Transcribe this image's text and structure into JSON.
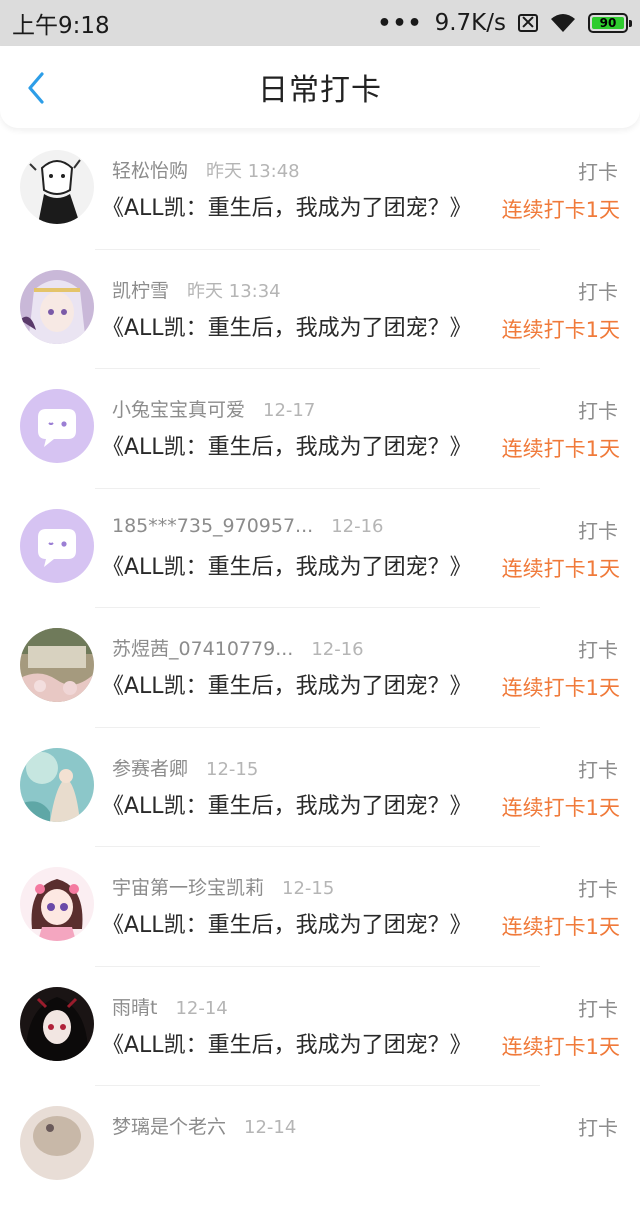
{
  "status_bar": {
    "time": "上午9:18",
    "dots": "•••",
    "speed": "9.7K/s",
    "battery": "90",
    "battery_color": "#2ecc2e"
  },
  "header": {
    "title": "日常打卡",
    "back_icon": "chevron-left-icon",
    "accent": "#2d9ee8"
  },
  "colors": {
    "streak": "#f07a3a",
    "muted": "#8c8c8c"
  },
  "entries": [
    {
      "user": "轻松怡购",
      "time": "昨天 13:48",
      "book": "《ALL凯：重生后，我成为了团宠？》",
      "action": "打卡",
      "streak": "连续打卡1天",
      "avatar": "sketch-avatar"
    },
    {
      "user": "凯柠雪",
      "time": "昨天 13:34",
      "book": "《ALL凯：重生后，我成为了团宠？》",
      "action": "打卡",
      "streak": "连续打卡1天",
      "avatar": "anime-avatar"
    },
    {
      "user": "小兔宝宝真可爱",
      "time": "12-17",
      "book": "《ALL凯：重生后，我成为了团宠？》",
      "action": "打卡",
      "streak": "连续打卡1天",
      "avatar": "default-chat-avatar"
    },
    {
      "user": "185***735_970957...",
      "time": "12-16",
      "book": "《ALL凯：重生后，我成为了团宠？》",
      "action": "打卡",
      "streak": "连续打卡1天",
      "avatar": "default-chat-avatar"
    },
    {
      "user": "苏煜茜_07410779...",
      "time": "12-16",
      "book": "《ALL凯：重生后，我成为了团宠？》",
      "action": "打卡",
      "streak": "连续打卡1天",
      "avatar": "photo-avatar"
    },
    {
      "user": "参赛者卿",
      "time": "12-15",
      "book": "《ALL凯：重生后，我成为了团宠？》",
      "action": "打卡",
      "streak": "连续打卡1天",
      "avatar": "art-avatar"
    },
    {
      "user": "宇宙第一珍宝凯莉",
      "time": "12-15",
      "book": "《ALL凯：重生后，我成为了团宠？》",
      "action": "打卡",
      "streak": "连续打卡1天",
      "avatar": "anime-girl-avatar"
    },
    {
      "user": "雨晴t",
      "time": "12-14",
      "book": "《ALL凯：重生后，我成为了团宠？》",
      "action": "打卡",
      "streak": "连续打卡1天",
      "avatar": "dark-anime-avatar"
    },
    {
      "user": "梦璃是个老六",
      "time": "12-14",
      "book": "",
      "action": "打卡",
      "streak": "",
      "avatar": "partial-avatar"
    }
  ]
}
